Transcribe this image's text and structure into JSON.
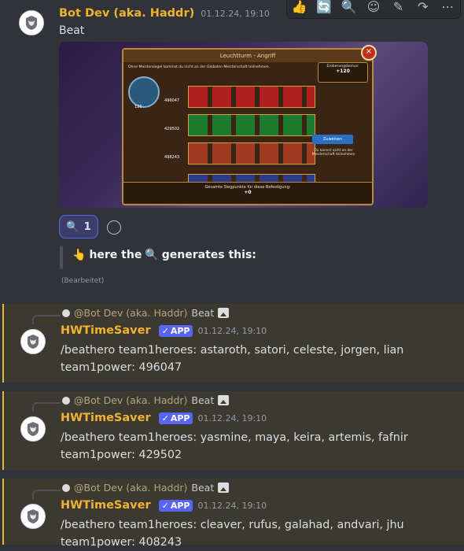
{
  "message1": {
    "author": "Bot Dev (aka. Haddr)",
    "timestamp": "01.12.24, 19:10",
    "text": "Beat",
    "reaction": {
      "emoji": "🔍",
      "count": "1"
    },
    "quote_text": "here the",
    "quote_text_tail": "generates this:",
    "edited": "(Bearbeitet)",
    "screenshot": {
      "title": "Leuchtturm - Angriff",
      "subtitle": "Ohne Meistersiegel kommst du nicht an der Globalen Meisterschaft teilnehmen.",
      "bonus_label": "Eroberungsbonus:",
      "bonus_value": "+120",
      "powers": [
        "496047",
        "429502",
        "498243"
      ],
      "tower_level": "126",
      "button": "Zuweisen",
      "side_note": "Du kannst nicht an der Meisterschaft teilnehmen",
      "footer": "Gesamte Siegpunkte für diese Befestigung:",
      "footer_value": "+0"
    }
  },
  "toolbar": [
    "👍",
    "🔄",
    "🔍",
    "☺",
    "✎",
    "↷",
    "⋯"
  ],
  "replies": [
    {
      "reply_author": "@Bot Dev (aka. Haddr)",
      "reply_text": "Beat",
      "author": "HWTimeSaver",
      "badge": "APP",
      "timestamp": "01.12.24, 19:10",
      "line1": "/beathero team1heroes: astaroth, satori, celeste, jorgen, lian",
      "line2": "team1power: 496047"
    },
    {
      "reply_author": "@Bot Dev (aka. Haddr)",
      "reply_text": "Beat",
      "author": "HWTimeSaver",
      "badge": "APP",
      "timestamp": "01.12.24, 19:10",
      "line1": "/beathero team1heroes: yasmine, maya, keira, artemis, fafnir",
      "line2": "team1power: 429502"
    },
    {
      "reply_author": "@Bot Dev (aka. Haddr)",
      "reply_text": "Beat",
      "author": "HWTimeSaver",
      "badge": "APP",
      "timestamp": "01.12.24, 19:10",
      "line1": "/beathero team1heroes: cleaver, rufus, galahad, andvari, jhu",
      "line2": "team1power: 408243"
    }
  ],
  "colors": {
    "author": "#f0b232",
    "badge": "#5865f2",
    "highlight_bg": "#3c3a30"
  }
}
